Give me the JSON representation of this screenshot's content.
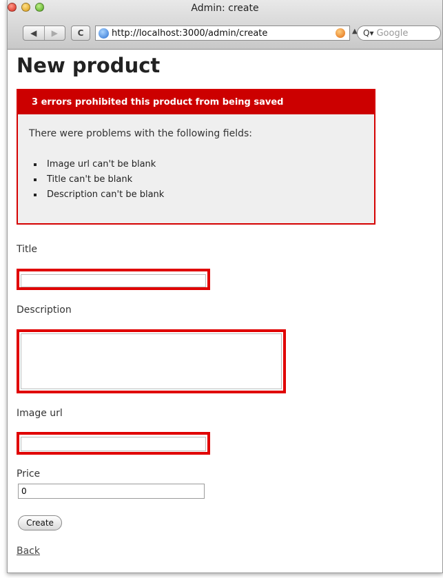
{
  "window": {
    "title": "Admin: create"
  },
  "toolbar": {
    "back_glyph": "◀",
    "forward_glyph": "▶",
    "reload_glyph": "C",
    "url": "http://localhost:3000/admin/create",
    "search_placeholder": "Google"
  },
  "page": {
    "heading": "New product",
    "errors": {
      "header": "3 errors prohibited this product from being saved",
      "intro": "There were problems with the following fields:",
      "items": [
        "Image url can't be blank",
        "Title can't be blank",
        "Description can't be blank"
      ]
    },
    "form": {
      "title_label": "Title",
      "title_value": "",
      "description_label": "Description",
      "description_value": "",
      "image_url_label": "Image url",
      "image_url_value": "",
      "price_label": "Price",
      "price_value": "0",
      "submit_label": "Create"
    },
    "back_link": "Back"
  },
  "colors": {
    "error_red": "#cc0000",
    "error_bg": "#efefef"
  }
}
